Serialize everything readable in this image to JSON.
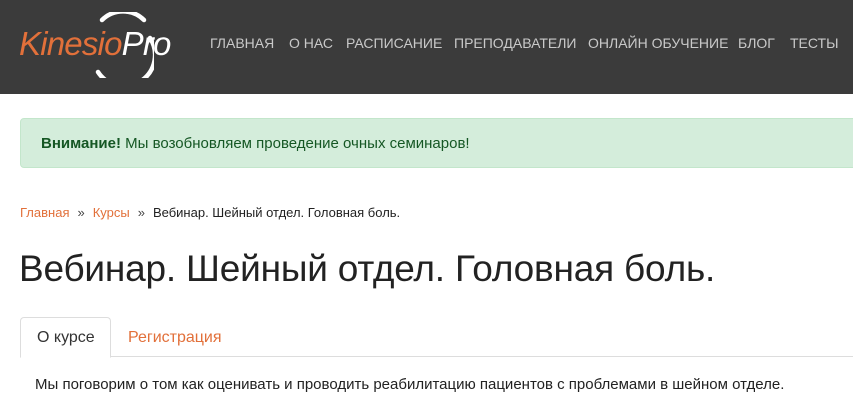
{
  "logo": {
    "part1": "Kinesio",
    "part2": "Pro"
  },
  "nav": {
    "items": [
      {
        "label": "ГЛАВНАЯ"
      },
      {
        "label": "О НАС"
      },
      {
        "label": "РАСПИСАНИЕ"
      },
      {
        "label": "ПРЕПОДАВАТЕЛИ"
      },
      {
        "label": "ОНЛАЙН ОБУЧЕНИЕ"
      },
      {
        "label": "БЛОГ"
      },
      {
        "label": "ТЕСТЫ"
      }
    ]
  },
  "alert": {
    "strong": "Внимание!",
    "text": " Мы возобновляем проведение очных семинаров!"
  },
  "breadcrumb": {
    "home": "Главная",
    "courses": "Курсы",
    "separator": "»",
    "current": "Вебинар. Шейный отдел. Головная боль."
  },
  "page": {
    "title": "Вебинар. Шейный отдел. Головная боль."
  },
  "tabs": [
    {
      "label": "О курсе"
    },
    {
      "label": "Регистрация"
    }
  ],
  "content": {
    "text": "Мы поговорим о том как оценивать и проводить реабилитацию пациентов с проблемами в шейном отделе."
  },
  "colors": {
    "accent": "#e2703a",
    "header_bg": "#3b3b3b",
    "alert_bg": "#d4eddb",
    "alert_text": "#155724"
  }
}
